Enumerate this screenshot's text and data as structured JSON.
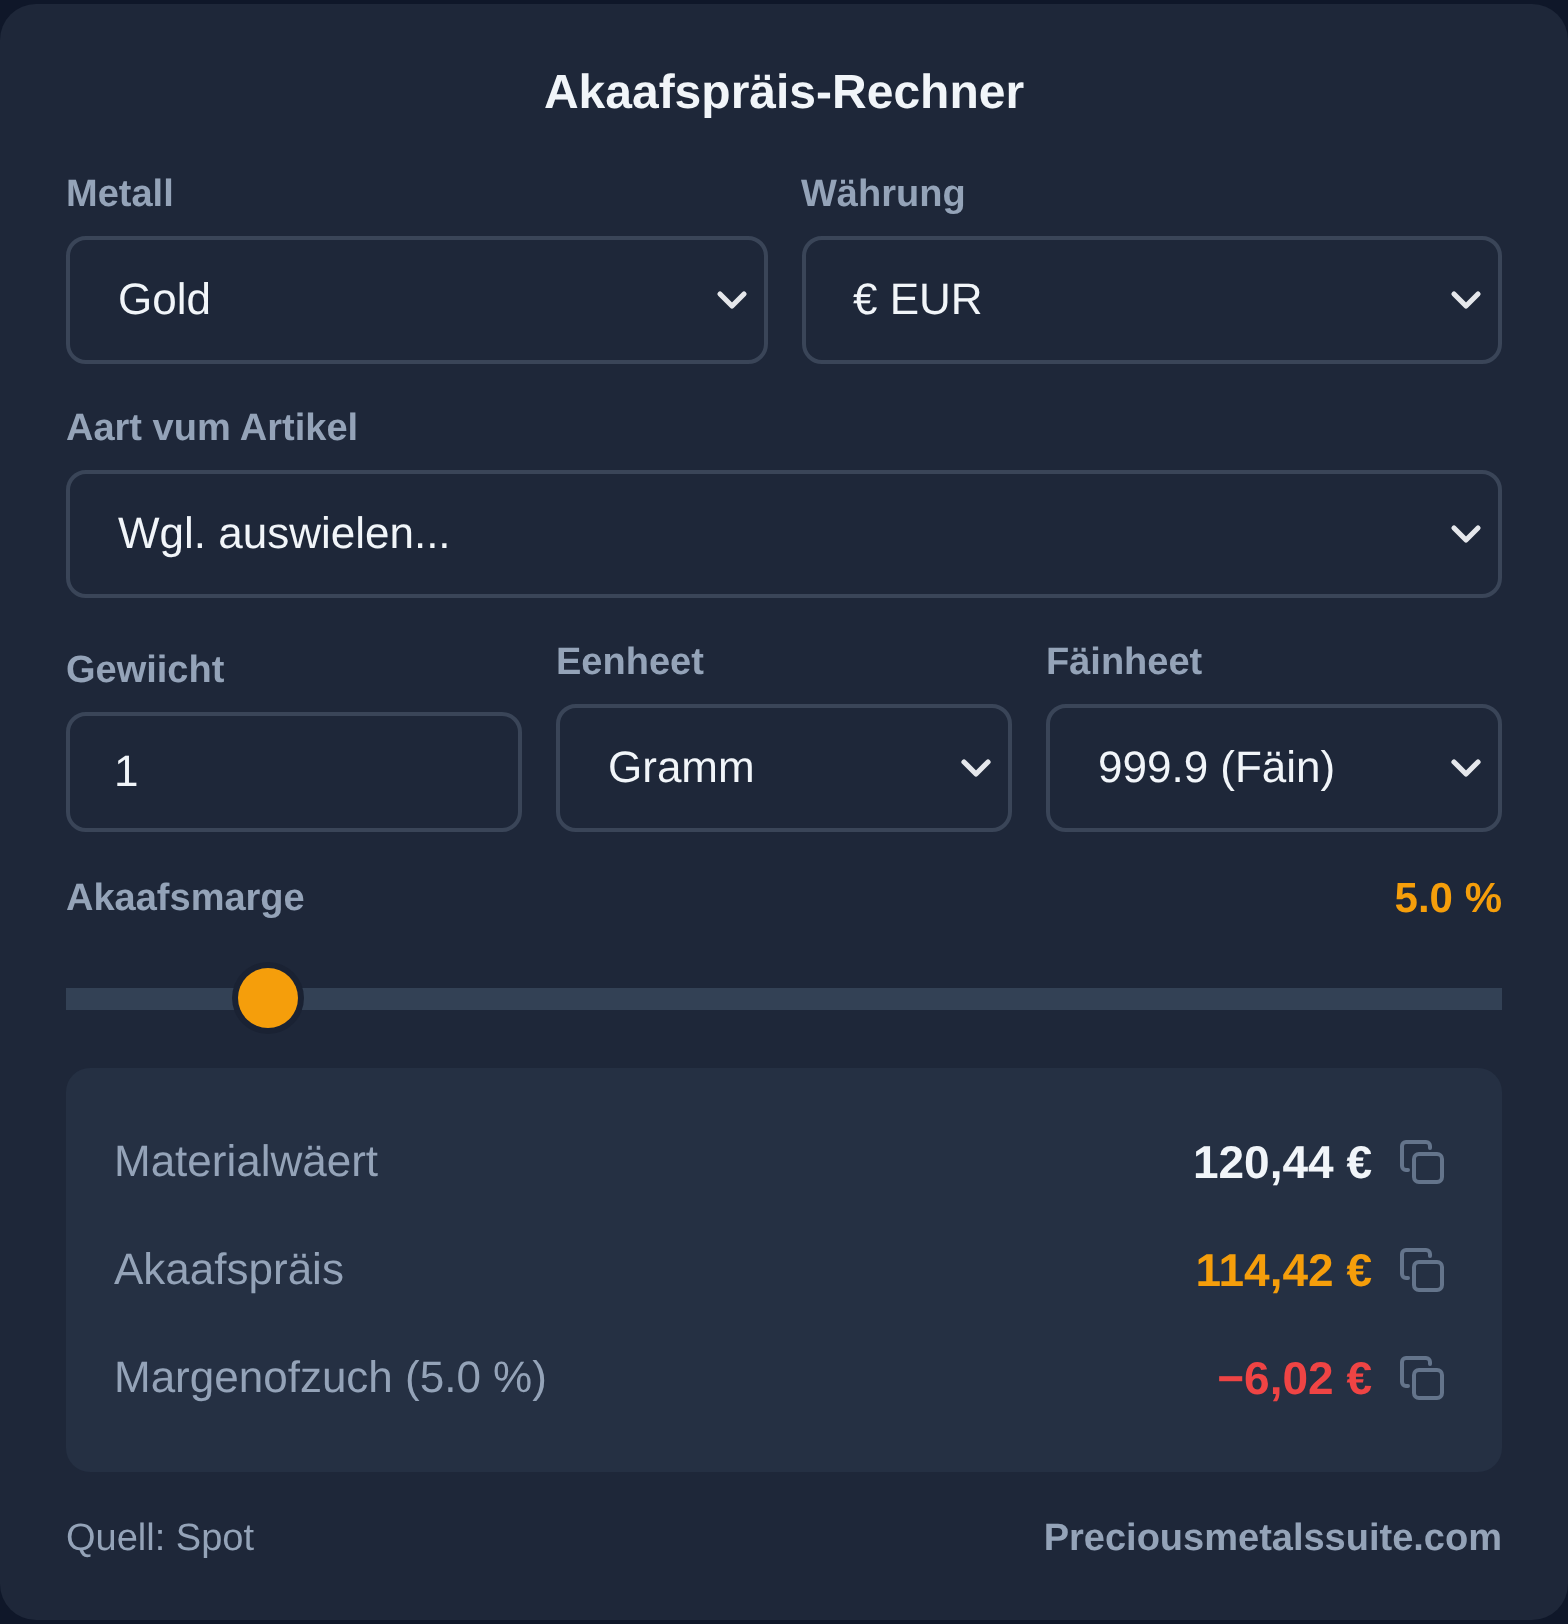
{
  "title": "Akaafspräis-Rechner",
  "field_rows": [
    {
      "fields": [
        {
          "kind": "select",
          "label": "Metall",
          "value": "Gold"
        },
        {
          "kind": "select",
          "label": "Währung",
          "value": "€ EUR"
        }
      ]
    },
    {
      "fields": [
        {
          "kind": "select",
          "label": "Aart vum Artikel",
          "value": "Wgl. auswielen..."
        }
      ]
    },
    {
      "fields": [
        {
          "kind": "input",
          "label": "Gewiicht",
          "value": "1"
        },
        {
          "kind": "select",
          "label": "Eenheet",
          "value": "Gramm"
        },
        {
          "kind": "select",
          "label": "Fäinheet",
          "value": "999.9 (Fäin)"
        }
      ]
    }
  ],
  "margin": {
    "label": "Akaafsmarge",
    "reading": "5.0 %",
    "level": 0.125
  },
  "results": [
    {
      "label": "Materialwäert",
      "value": "120,44 €",
      "color": "#f1f5f9"
    },
    {
      "label": "Akaafspräis",
      "value": "114,42 €",
      "color": "#f59e0b"
    },
    {
      "label": "Margenofzuch (5.0 %)",
      "value": "−6,02 €",
      "color": "#ef4444"
    }
  ],
  "footer": {
    "source": "Quell: Spot",
    "brand": "Preciousmetalssuite.com"
  }
}
